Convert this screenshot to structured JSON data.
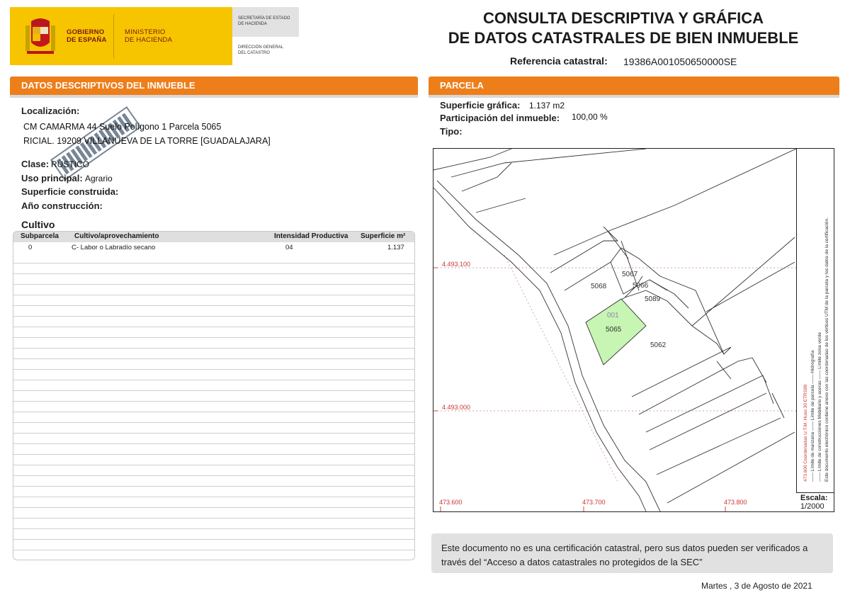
{
  "header": {
    "gobierno": "GOBIERNO\nDE ESPAÑA",
    "ministerio": "MINISTERIO\nDE HACIENDA",
    "secretaria": "SECRETARÍA DE ESTADO\nDE HACIENDA",
    "direccion": "DIRECCIÓN GENERAL\nDEL CATASTRO",
    "title_line1": "CONSULTA DESCRIPTIVA Y GRÁFICA",
    "title_line2": "DE DATOS CATASTRALES DE BIEN INMUEBLE",
    "ref_label": "Referencia catastral:",
    "ref_value": "19386A001050650000SE"
  },
  "datos": {
    "bar_title_prefix": "DATOS DESCRIPTIVOS DEL ",
    "bar_title_bold": "INMUEBLE",
    "localizacion_label": "Localización:",
    "address_line1": "CM CAMARMA 44 Suelo Polígono 1 Parcela 5065",
    "address_line2": "RICIAL. 19209 VILLANUEVA DE LA TORRE [GUADALAJARA]",
    "clase_label": "Clase:",
    "clase_value": "RÚSTICO",
    "uso_label": "Uso principal:",
    "uso_value": "Agrario",
    "sup_construida_label": "Superficie construida:",
    "anio_label": "Año construcción:"
  },
  "cultivo": {
    "title": "Cultivo",
    "headers": [
      "Subparcela",
      "Cultivo/aprovechamiento",
      "Intensidad Productiva",
      "Superficie m²"
    ],
    "rows": [
      {
        "subparcela": "0",
        "cultivo": "C- Labor o Labradío secano",
        "intensidad": "04",
        "superficie": "1.137"
      }
    ]
  },
  "parcela": {
    "bar_title": "PARCELA",
    "sup_grafica_label": "Superficie gráfica:",
    "sup_grafica_value": "1.137 m2",
    "participacion_label": "Participación del inmueble:",
    "participacion_value": "100,00 %",
    "tipo_label": "Tipo:",
    "map": {
      "coord_y1": "4.493.100",
      "coord_y2": "4.493.000",
      "coord_x1": "473.600",
      "coord_x2": "473.700",
      "coord_x3": "473.800",
      "parcels": [
        "5067",
        "5066",
        "5068",
        "5089",
        "001",
        "5065",
        "5062"
      ],
      "escala_label": "Escala:",
      "escala_value": "1/2000",
      "legend_col1": "473.600 Coordenadas U.T.M. Huso 30 ETRS89",
      "legend_col2": "—— Límite de manzana     —— Límite de parcela     —— Hidrografía",
      "legend_col3": "—— Límite de construcciones     Mobiliario y aceras     —— Límite zona verde",
      "legend_col4": "Este documento electrónico contiene anexo con las coordenadas de los vértices UTM de la parcela y los datos de la certificación."
    },
    "accent_color": "#ee7e1a",
    "highlight_color": "#c6f5b4"
  },
  "note": {
    "text": "Este documento no es una certificación catastral, pero sus datos pueden ser verificados a través del “Acceso a datos catastrales no protegidos de la SEC”"
  },
  "date": "Martes , 3 de Agosto de 2021"
}
